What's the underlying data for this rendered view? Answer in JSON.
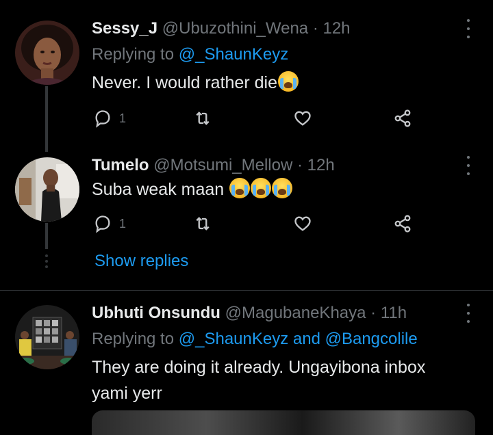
{
  "tweets": [
    {
      "name": "Sessy_J",
      "handle": "@Ubuzothini_Wena",
      "time": "12h",
      "replying_prefix": "Replying to",
      "mentions": [
        "@_ShaunKeyz"
      ],
      "text": "Never. I would rather die",
      "reply_count": "1",
      "emoji": [
        "loudly-crying-face"
      ]
    },
    {
      "name": "Tumelo",
      "handle": "@Motsumi_Mellow",
      "time": "12h",
      "text": "Suba weak maan",
      "reply_count": "1",
      "emoji": [
        "loudly-crying-face",
        "loudly-crying-face",
        "loudly-crying-face"
      ]
    },
    {
      "name": "Ubhuti Onsundu",
      "handle": "@MagubaneKhaya",
      "time": "11h",
      "replying_prefix": "Replying to",
      "mentions": [
        "@_ShaunKeyz",
        "@Bangcolile"
      ],
      "mention_joiner": "and",
      "text_lines": [
        "They are doing it already. Ungayibona inbox",
        "yami yerr"
      ]
    }
  ],
  "show_replies": "Show replies",
  "separator": "·",
  "colors": {
    "background": "#000000",
    "text": "#e7e9ea",
    "secondary": "#71767b",
    "accent": "#1d9bf0"
  },
  "icons": [
    "reply-icon",
    "retweet-icon",
    "like-icon",
    "share-icon",
    "more-icon"
  ]
}
